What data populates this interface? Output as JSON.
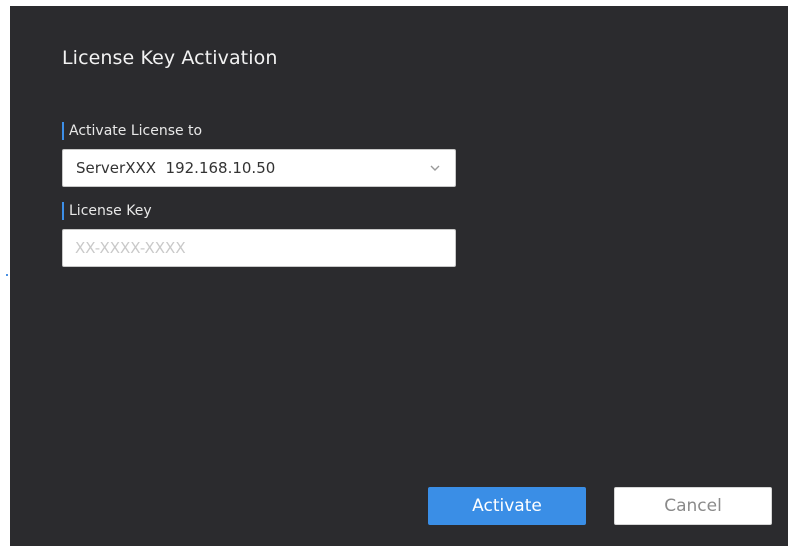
{
  "dialog": {
    "title": "License Key Activation",
    "activate_to": {
      "label": "Activate License to",
      "selected_value": "ServerXXX  192.168.10.50",
      "icon": "chevron-down-icon"
    },
    "license_key": {
      "label": "License Key",
      "value": "",
      "placeholder": "XX-XXXX-XXXX"
    },
    "buttons": {
      "activate_label": "Activate",
      "cancel_label": "Cancel"
    }
  },
  "colors": {
    "dialog_background": "#2b2b2e",
    "accent": "#3a8ee6",
    "label_marker": "#3d8fe8"
  }
}
